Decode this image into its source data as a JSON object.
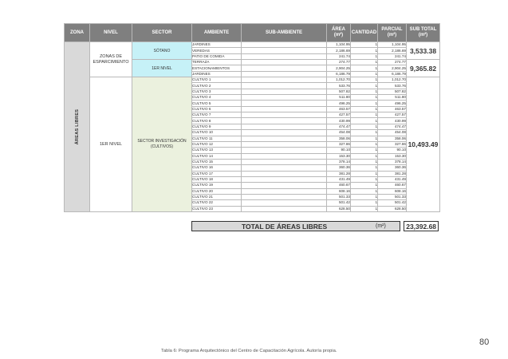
{
  "table": {
    "headers": {
      "zona": "ZONA",
      "nivel": "NIVEL",
      "sector": "SECTOR",
      "ambiente": "AMBIENTE",
      "sub_ambiente": "SUB-AMBIENTE",
      "area": "ÁREA",
      "area_unit": "(m²)",
      "cantidad": "CANTIDAD",
      "parcial": "PARCIAL",
      "parcial_unit": "(m²)",
      "subtotal": "SUB TOTAL",
      "subtotal_unit": "(m²)"
    },
    "zona_label": "ÁREAS LIBRES",
    "nivel_1": "ZONAS DE ESPARCIMIENTO",
    "nivel_2": "1ER NIVEL",
    "sector_sotano": "SÓTANO",
    "sector_1er_nivel": "1ER NIVEL",
    "sector_investigacion": "SECTOR INVESTIGACIÓN (CULTIVOS)",
    "subtotal_sotano": "3,533.38",
    "subtotal_1er_nivel": "9,365.82",
    "subtotal_investigacion": "10,493.49",
    "rows": [
      {
        "ambiente": "JARDINES",
        "area": "1,104.95",
        "cantidad": "1",
        "parcial": "1,104.95"
      },
      {
        "ambiente": "VEREDAS",
        "area": "2,186.69",
        "cantidad": "1",
        "parcial": "2,186.69"
      },
      {
        "ambiente": "PATIO DE COMIDA",
        "area": "241.74",
        "cantidad": "1",
        "parcial": "241.74"
      },
      {
        "ambiente": "TERRAZA",
        "area": "274.77",
        "cantidad": "1",
        "parcial": "274.77"
      },
      {
        "ambiente": "ESTACIONAMIENTOS",
        "area": "2,904.25",
        "cantidad": "1",
        "parcial": "2,904.25"
      },
      {
        "ambiente": "JARDINES",
        "area": "6,186.79",
        "cantidad": "1",
        "parcial": "6,186.79"
      },
      {
        "ambiente": "CULTIVO 1",
        "area": "1,012.70",
        "cantidad": "1",
        "parcial": "1,012.70"
      },
      {
        "ambiente": "CULTIVO 2",
        "area": "533.76",
        "cantidad": "1",
        "parcial": "533.76"
      },
      {
        "ambiente": "CULTIVO 3",
        "area": "507.82",
        "cantidad": "1",
        "parcial": "507.82"
      },
      {
        "ambiente": "CULTIVO 4",
        "area": "511.80",
        "cantidad": "1",
        "parcial": "511.80"
      },
      {
        "ambiente": "CULTIVO 5",
        "area": "496.25",
        "cantidad": "1",
        "parcial": "496.25"
      },
      {
        "ambiente": "CULTIVO 6",
        "area": "463.57",
        "cantidad": "1",
        "parcial": "463.57"
      },
      {
        "ambiente": "CULTIVO 7",
        "area": "427.57",
        "cantidad": "1",
        "parcial": "427.57"
      },
      {
        "ambiente": "CULTIVO 8",
        "area": "430.99",
        "cantidad": "1",
        "parcial": "430.99"
      },
      {
        "ambiente": "CULTIVO 9",
        "area": "474.47",
        "cantidad": "1",
        "parcial": "474.47"
      },
      {
        "ambiente": "CULTIVO 10",
        "area": "454.08",
        "cantidad": "1",
        "parcial": "454.08"
      },
      {
        "ambiente": "CULTIVO 11",
        "area": "358.06",
        "cantidad": "1",
        "parcial": "358.06"
      },
      {
        "ambiente": "CULTIVO 12",
        "area": "327.86",
        "cantidad": "1",
        "parcial": "327.86"
      },
      {
        "ambiente": "CULTIVO 13",
        "area": "90.10",
        "cantidad": "1",
        "parcial": "90.10"
      },
      {
        "ambiente": "CULTIVO 14",
        "area": "153.30",
        "cantidad": "1",
        "parcial": "153.30"
      },
      {
        "ambiente": "CULTIVO 15",
        "area": "378.14",
        "cantidad": "1",
        "parcial": "378.14"
      },
      {
        "ambiente": "CULTIVO 16",
        "area": "360.36",
        "cantidad": "1",
        "parcial": "360.36"
      },
      {
        "ambiente": "CULTIVO 17",
        "area": "381.28",
        "cantidad": "1",
        "parcial": "381.28"
      },
      {
        "ambiente": "CULTIVO 18",
        "area": "431.49",
        "cantidad": "1",
        "parcial": "431.49"
      },
      {
        "ambiente": "CULTIVO 19",
        "area": "460.67",
        "cantidad": "1",
        "parcial": "460.67"
      },
      {
        "ambiente": "CULTIVO 20",
        "area": "608.16",
        "cantidad": "1",
        "parcial": "608.16"
      },
      {
        "ambiente": "CULTIVO 21",
        "area": "501.33",
        "cantidad": "1",
        "parcial": "501.33"
      },
      {
        "ambiente": "CULTIVO 22",
        "area": "501.42",
        "cantidad": "1",
        "parcial": "501.42"
      },
      {
        "ambiente": "CULTIVO 23",
        "area": "628.50",
        "cantidad": "1",
        "parcial": "628.50"
      }
    ]
  },
  "total": {
    "label": "TOTAL DE ÁREAS LIBRES",
    "unit": "(m²)",
    "value": "23,392.68"
  },
  "page_number": "80",
  "caption": "Tabla 6:  Programa Arquitectónico del Centro de Capacitación Agrícola. Autoría propia."
}
